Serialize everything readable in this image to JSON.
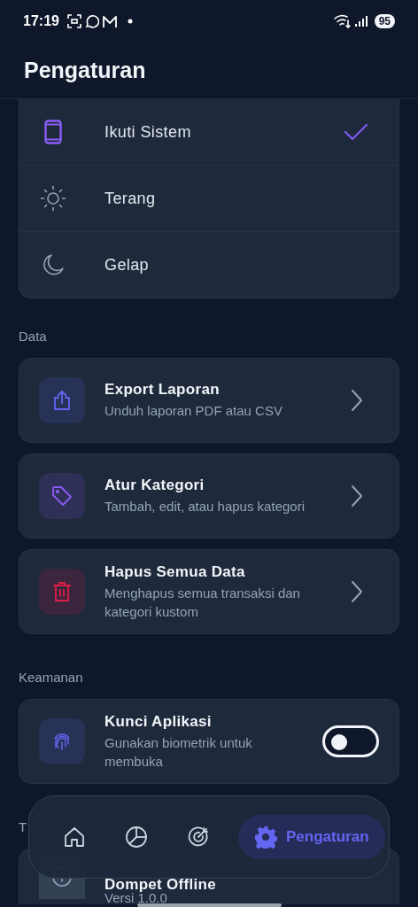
{
  "status_bar": {
    "time": "17:19",
    "battery": "95"
  },
  "header": {
    "title": "Pengaturan"
  },
  "theme_options": [
    {
      "label": "Ikuti Sistem",
      "selected": true
    },
    {
      "label": "Terang",
      "selected": false
    },
    {
      "label": "Gelap",
      "selected": false
    }
  ],
  "sections": [
    {
      "title": "Data",
      "items": [
        {
          "kind": "link",
          "color": "#6366f1",
          "title": "Export Laporan",
          "subtitle": "Unduh laporan PDF atau CSV"
        },
        {
          "kind": "link",
          "color": "#8b5cf6",
          "title": "Atur Kategori",
          "subtitle": "Tambah, edit, atau hapus kategori"
        },
        {
          "kind": "link",
          "color": "#e11d48",
          "title": "Hapus Semua Data",
          "subtitle": "Menghapus semua transaksi dan kategori kustom"
        }
      ]
    },
    {
      "title": "Keamanan",
      "items": [
        {
          "kind": "toggle",
          "color": "#6366f1",
          "title": "Kunci Aplikasi",
          "subtitle": "Gunakan biometrik untuk membuka",
          "on": false
        }
      ]
    },
    {
      "title": "T",
      "items": [
        {
          "kind": "info",
          "title": "Dompet Offline",
          "subtitle": "Versi 1.0.0"
        }
      ]
    }
  ],
  "nav": [
    {
      "selected": false
    },
    {
      "selected": false
    },
    {
      "selected": false
    },
    {
      "label": "Pengaturan",
      "selected": true
    }
  ]
}
